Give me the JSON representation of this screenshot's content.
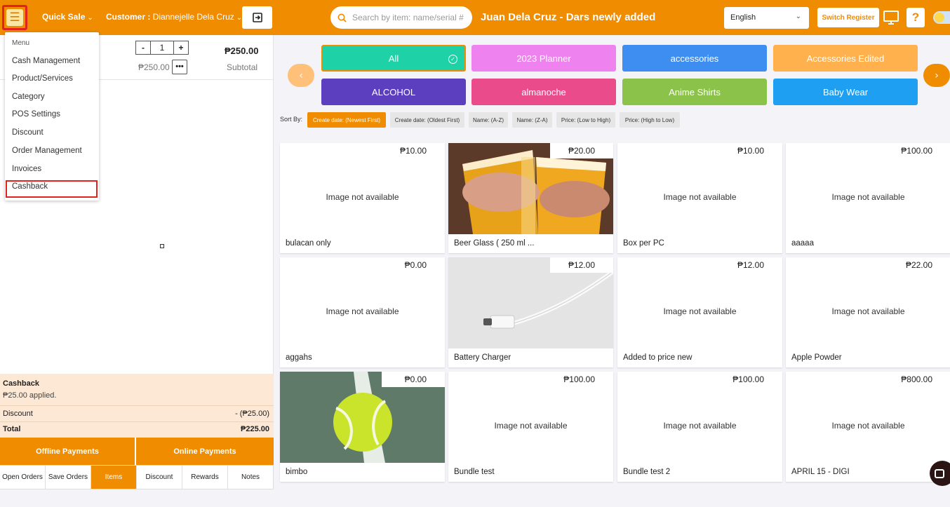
{
  "topbar": {
    "sale_mode": "Quick Sale",
    "customer_label": "Customer :",
    "customer_name": "Diannejelle Dela Cruz",
    "search_placeholder": "Search by item: name/serial #",
    "shop_title": "Juan Dela Cruz - Dars newly added",
    "language": "English",
    "switch_register": "Switch Register",
    "help": "?",
    "accent_color": "#f08c00"
  },
  "menu": {
    "header": "Menu",
    "items": [
      "Cash Management",
      "Product/Services",
      "Category",
      "POS Settings",
      "Discount",
      "Order Management",
      "Invoices",
      "Cashback"
    ],
    "highlighted": "Cashback"
  },
  "cart": {
    "qty_minus": "-",
    "qty": "1",
    "qty_plus": "+",
    "line_total": "₱250.00",
    "unit_price": "₱250.00",
    "more": "•••",
    "subtotal_label": "Subtotal"
  },
  "summary": {
    "cashback_title": "Cashback",
    "cashback_applied": "₱25.00 applied.",
    "discount_label": "Discount",
    "discount_value": "- (₱25.00)",
    "total_label": "Total",
    "total_value": "₱225.00"
  },
  "payments": {
    "offline": "Offline Payments",
    "online": "Online Payments"
  },
  "bottom_tabs": [
    "Open Orders",
    "Save Orders",
    "Items",
    "Discount",
    "Rewards",
    "Notes"
  ],
  "active_tab": "Items",
  "categories": [
    {
      "label": "All",
      "color": "#1fd1a6",
      "selected": true
    },
    {
      "label": "2023 Planner",
      "color": "#ee82ee",
      "selected": false
    },
    {
      "label": "accessories",
      "color": "#3d8ef0",
      "selected": false
    },
    {
      "label": "Accessories Edited",
      "color": "#ffb14d",
      "selected": false
    },
    {
      "label": "ALCOHOL",
      "color": "#5b3fbf",
      "selected": false
    },
    {
      "label": "almanoche",
      "color": "#ea4b8b",
      "selected": false
    },
    {
      "label": "Anime Shirts",
      "color": "#8bc34a",
      "selected": false
    },
    {
      "label": "Baby Wear",
      "color": "#1e9ff2",
      "selected": false
    }
  ],
  "sort": {
    "label": "Sort By:",
    "options": [
      "Create date: (Newest First)",
      "Create date: (Oldest First)",
      "Name: (A-Z)",
      "Name: (Z-A)",
      "Price: (Low to High)",
      "Price: (High to Low)"
    ],
    "active": "Create date: (Newest First)"
  },
  "no_image_text": "Image not available",
  "products": [
    {
      "name": "bulacan only",
      "price": "₱10.00",
      "image": "none"
    },
    {
      "name": "Beer Glass ( 250 ml ...",
      "price": "₱20.00",
      "image": "beer-glasses"
    },
    {
      "name": "Box per PC",
      "price": "₱10.00",
      "image": "none"
    },
    {
      "name": "aaaaa",
      "price": "₱100.00",
      "image": "none"
    },
    {
      "name": "aggahs",
      "price": "₱0.00",
      "image": "none"
    },
    {
      "name": "Battery Charger",
      "price": "₱12.00",
      "image": "usb-cable"
    },
    {
      "name": "Added to price new",
      "price": "₱12.00",
      "image": "none"
    },
    {
      "name": "Apple Powder",
      "price": "₱22.00",
      "image": "none"
    },
    {
      "name": "bimbo",
      "price": "₱0.00",
      "image": "tennis-ball"
    },
    {
      "name": "Bundle test",
      "price": "₱100.00",
      "image": "none"
    },
    {
      "name": "Bundle test 2",
      "price": "₱100.00",
      "image": "none"
    },
    {
      "name": "APRIL 15 - DIGI",
      "price": "₱800.00",
      "image": "none"
    }
  ]
}
